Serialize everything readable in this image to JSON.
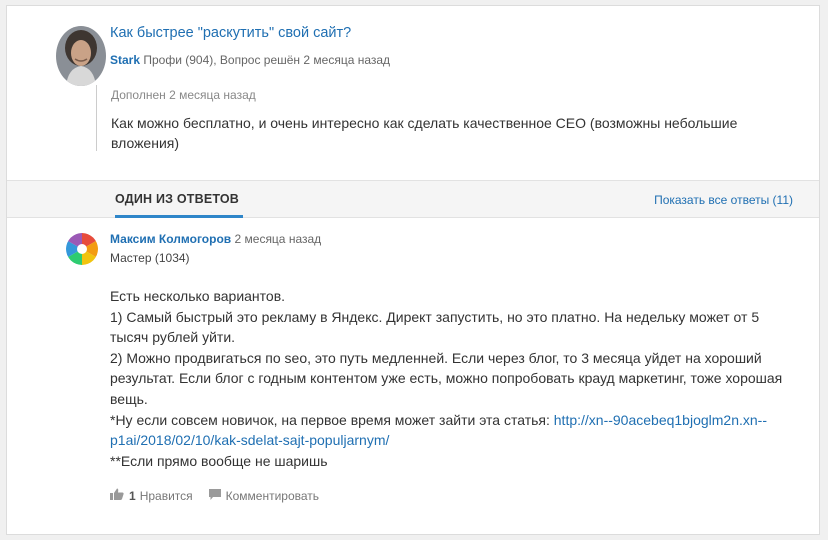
{
  "question": {
    "title": "Как быстрее \"раскутить\" свой сайт?",
    "author": "Stark",
    "meta": " Профи (904), Вопрос решён 2 месяца назад",
    "addition_label": "Дополнен 2 месяца назад",
    "addition_text": "Как можно бесплатно, и очень интересно как сделать качественное СЕО (возможны небольшие вложения)"
  },
  "answers_bar": {
    "tab_label": "ОДИН ИЗ ОТВЕТОВ",
    "show_all": "Показать все ответы (11)"
  },
  "answer": {
    "author": "Максим Колмогоров",
    "time": " 2 месяца назад",
    "rank": "Мастер (1034)",
    "body": {
      "line1": "Есть несколько вариантов.",
      "line2": "1) Самый быстрый это рекламу в Яндекс. Директ запустить, но это платно. На недельку может от 5 тысяч рублей уйти.",
      "line3": "2) Можно продвигаться по seo, это путь медленней. Если через блог, то 3 месяца уйдет на хороший результат. Если блог с годным контентом уже есть, можно попробовать крауд маркетинг, тоже хорошая вещь.",
      "line4_prefix": "*Ну если совсем новичок, на первое время может зайти эта статья: ",
      "link": "http://xn--90acebeq1bjoglm2n.xn--p1ai/2018/02/10/kak-sdelat-sajt-populjarnym/",
      "line5": "**Если прямо вообще не шаришь"
    },
    "likes": "1",
    "likes_label": "Нравится",
    "comment_label": "Комментировать"
  },
  "colors": {
    "link": "#1f6fb2",
    "tab_accent": "#2f86c9"
  }
}
